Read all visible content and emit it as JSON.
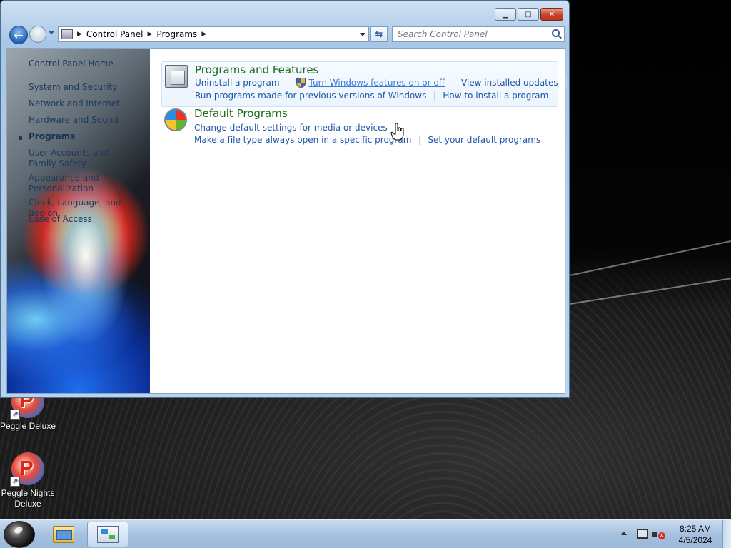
{
  "window": {
    "address": {
      "segments": [
        "Control Panel",
        "Programs"
      ]
    },
    "search": {
      "placeholder": "Search Control Panel"
    }
  },
  "left_nav": {
    "items": [
      {
        "label": "Control Panel Home",
        "active": false
      },
      {
        "label": "System and Security",
        "active": false
      },
      {
        "label": "Network and Internet",
        "active": false
      },
      {
        "label": "Hardware and Sound",
        "active": false
      },
      {
        "label": "Programs",
        "active": true
      },
      {
        "label": "User Accounts and Family Safety",
        "active": false
      },
      {
        "label": "Appearance and Personalization",
        "active": false
      },
      {
        "label": "Clock, Language, and Region",
        "active": false
      },
      {
        "label": "Ease of Access",
        "active": false
      }
    ]
  },
  "sections": {
    "programs_features": {
      "title": "Programs and Features",
      "links": {
        "uninstall": "Uninstall a program",
        "turn_features": "Turn Windows features on or off",
        "view_updates": "View installed updates",
        "run_previous": "Run programs made for previous versions of Windows",
        "how_install": "How to install a program"
      }
    },
    "default_programs": {
      "title": "Default Programs",
      "links": {
        "change_defaults": "Change default settings for media or devices",
        "file_type": "Make a file type always open in a specific program",
        "set_defaults": "Set your default programs"
      }
    }
  },
  "desktop": {
    "icons": [
      {
        "label": "Peggle Deluxe"
      },
      {
        "label": "Peggle Nights Deluxe"
      }
    ]
  },
  "taskbar": {
    "clock": {
      "time": "8:25 AM",
      "date": "4/5/2024"
    }
  },
  "colors": {
    "link": "#1f57a8",
    "section_title": "#1a6b1a",
    "taskbar": "#a6c1df"
  }
}
